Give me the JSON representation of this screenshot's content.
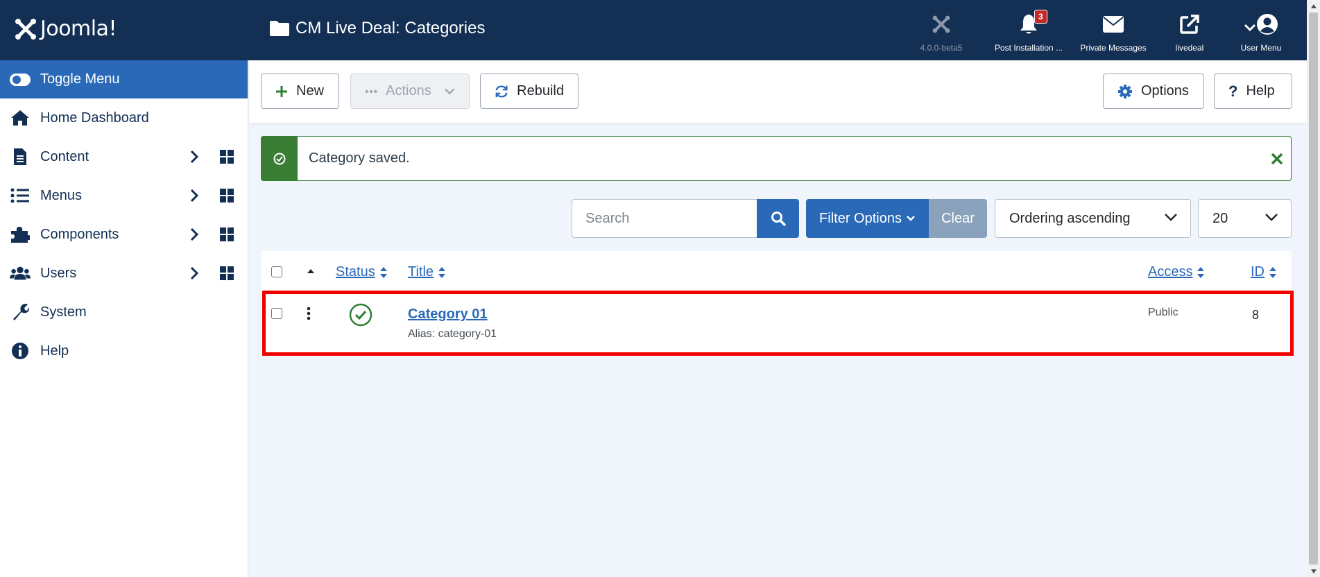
{
  "header": {
    "logo_text": "Joomla!",
    "page_title": "CM Live Deal: Categories",
    "items": [
      {
        "label": "4.0.0-beta5",
        "icon": "joomla-icon"
      },
      {
        "label": "Post Installation ...",
        "icon": "bell-icon",
        "badge": "3"
      },
      {
        "label": "Private Messages",
        "icon": "envelope-icon"
      },
      {
        "label": "livedeal",
        "icon": "external-link-icon"
      },
      {
        "label": "User Menu",
        "icon": "user-circle-icon"
      }
    ]
  },
  "sidebar": {
    "items": [
      {
        "label": "Toggle Menu",
        "icon": "toggle-icon"
      },
      {
        "label": "Home Dashboard",
        "icon": "home-icon"
      },
      {
        "label": "Content",
        "icon": "file-icon"
      },
      {
        "label": "Menus",
        "icon": "list-icon"
      },
      {
        "label": "Components",
        "icon": "puzzle-icon"
      },
      {
        "label": "Users",
        "icon": "users-icon"
      },
      {
        "label": "System",
        "icon": "wrench-icon"
      },
      {
        "label": "Help",
        "icon": "info-icon"
      }
    ]
  },
  "toolbar": {
    "new_label": "New",
    "actions_label": "Actions",
    "rebuild_label": "Rebuild",
    "options_label": "Options",
    "help_label": "Help"
  },
  "alert": {
    "message": "Category saved."
  },
  "filters": {
    "search_placeholder": "Search",
    "filter_options_label": "Filter Options",
    "clear_label": "Clear",
    "ordering": "Ordering ascending",
    "limit": "20"
  },
  "table": {
    "headers": {
      "status": "Status",
      "title": "Title",
      "access": "Access",
      "id": "ID"
    },
    "rows": [
      {
        "title": "Category 01",
        "alias": "Alias: category-01",
        "access": "Public",
        "id": "8"
      }
    ]
  },
  "colors": {
    "header_bg": "#132f53",
    "primary": "#2a69b8",
    "success": "#3a7d34",
    "highlight": "#f10000"
  }
}
